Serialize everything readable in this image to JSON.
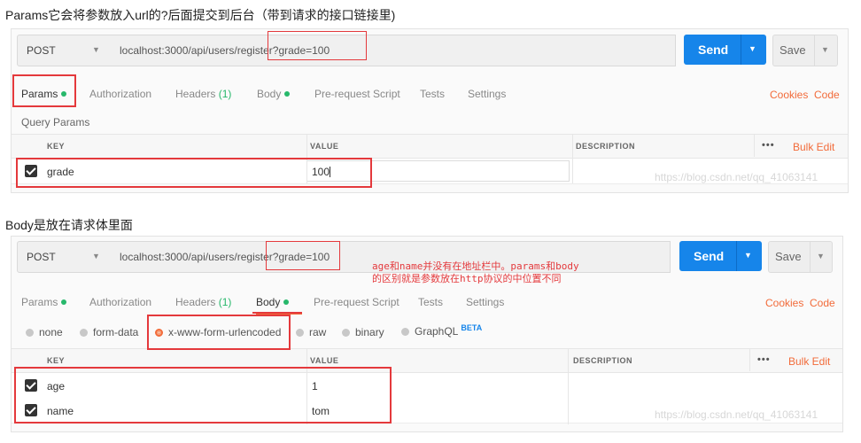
{
  "captions": {
    "top": "Params它会将参数放入url的?后面提交到后台（带到请求的接口链接里)",
    "middle": "Body是放在请求体里面"
  },
  "panel1": {
    "method": "POST",
    "url": "localhost:3000/api/users/register?grade=100",
    "send_label": "Send",
    "save_label": "Save",
    "tabs": [
      {
        "label": "Params",
        "dot": true
      },
      {
        "label": "Authorization"
      },
      {
        "label": "Headers",
        "count": "(1)"
      },
      {
        "label": "Body",
        "dot": true
      },
      {
        "label": "Pre-request Script"
      },
      {
        "label": "Tests"
      },
      {
        "label": "Settings"
      }
    ],
    "cookies_label": "Cookies",
    "code_label": "Code",
    "section_title": "Query Params",
    "columns": {
      "key": "KEY",
      "value": "VALUE",
      "description": "DESCRIPTION"
    },
    "more_label": "•••",
    "bulk_edit_label": "Bulk Edit",
    "rows": [
      {
        "key": "grade",
        "value": "100"
      }
    ],
    "watermark": "https://blog.csdn.net/qq_41063141"
  },
  "panel2": {
    "method": "POST",
    "url": "localhost:3000/api/users/register?grade=100",
    "send_label": "Send",
    "save_label": "Save",
    "tabs": [
      {
        "label": "Params",
        "dot": true
      },
      {
        "label": "Authorization"
      },
      {
        "label": "Headers",
        "count": "(1)"
      },
      {
        "label": "Body",
        "dot": true
      },
      {
        "label": "Pre-request Script"
      },
      {
        "label": "Tests"
      },
      {
        "label": "Settings"
      }
    ],
    "cookies_label": "Cookies",
    "code_label": "Code",
    "body_types": [
      "none",
      "form-data",
      "x-www-form-urlencoded",
      "raw",
      "binary",
      "GraphQL"
    ],
    "beta_label": "BETA",
    "columns": {
      "key": "KEY",
      "value": "VALUE",
      "description": "DESCRIPTION"
    },
    "more_label": "•••",
    "bulk_edit_label": "Bulk Edit",
    "rows": [
      {
        "key": "age",
        "value": "1"
      },
      {
        "key": "name",
        "value": "tom"
      }
    ],
    "note_line1": "age和name并没有在地址栏中。params和body",
    "note_line2": "的区别就是参数放在http协议的中位置不同",
    "watermark": "https://blog.csdn.net/qq_41063141"
  },
  "colors": {
    "accent": "#1685ea",
    "annotation": "#e4393c",
    "link": "#f26b3a",
    "dot": "#27b86b"
  }
}
